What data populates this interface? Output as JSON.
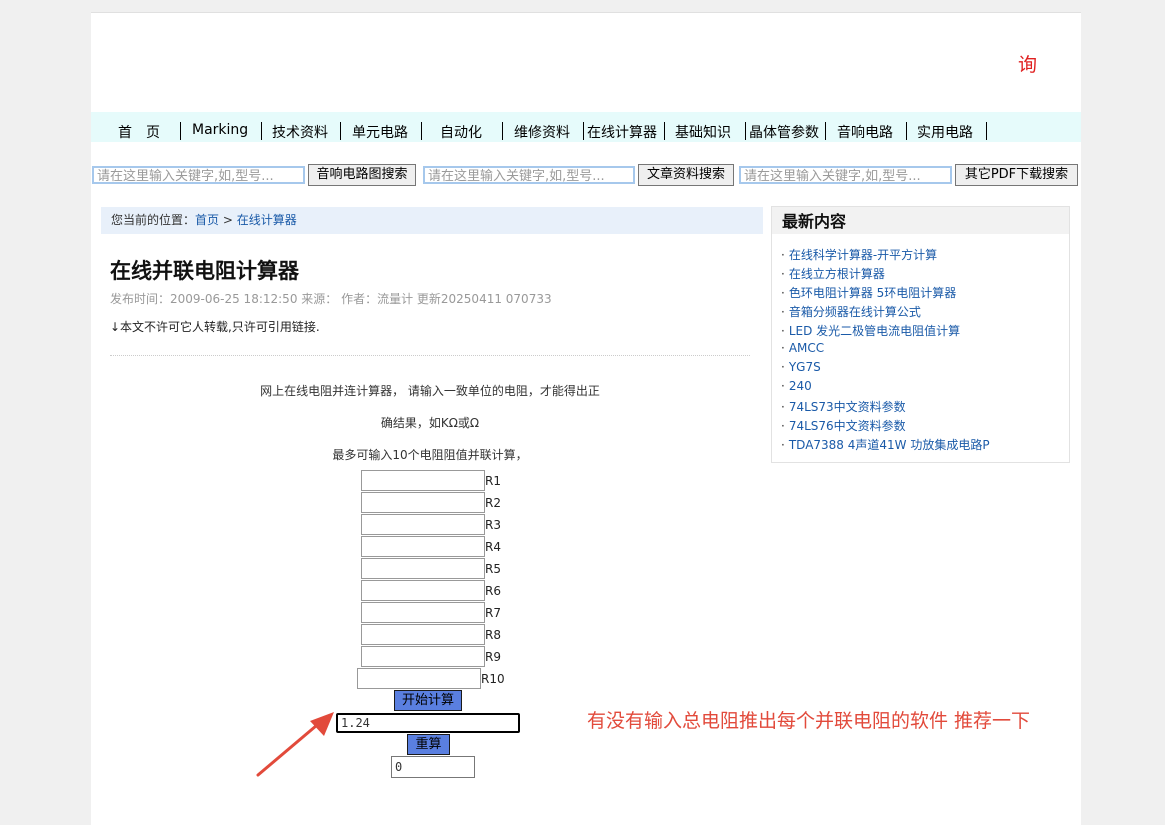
{
  "header": {
    "query_char": "询"
  },
  "nav": [
    "首　页",
    "Marking",
    "技术资料",
    "单元电路",
    "自动化",
    "维修资料",
    "在线计算器",
    "基础知识",
    "晶体管参数",
    "音响电路",
    "实用电路"
  ],
  "search": {
    "placeholder1": "请在这里输入关键字,如,型号...",
    "button1": "音响电路图搜索",
    "placeholder2": "请在这里输入关键字,如,型号...",
    "button2": "文章资料搜索",
    "placeholder3": "请在这里输入关键字,如,型号...",
    "button3": "其它PDF下载搜索"
  },
  "breadcrumb": {
    "prefix": "您当前的位置：",
    "home": "首页",
    "sep": " > ",
    "current": "在线计算器"
  },
  "article": {
    "title": "在线并联电阻计算器",
    "meta": "发布时间：2009-06-25 18:12:50  来源：   作者：流量计  更新20250411 070733",
    "notice": "↓本文不许可它人转载,只许可引用链接.",
    "intro1": "网上在线电阻并连计算器， 请输入一致单位的电阻，才能得出正",
    "intro2": "确结果，如KΩ或Ω",
    "intro3": "最多可输入10个电阻阻值并联计算，"
  },
  "calculator": {
    "labels": [
      "R1",
      "R2",
      "R3",
      "R4",
      "R5",
      "R6",
      "R7",
      "R8",
      "R9",
      "R10"
    ],
    "start_button": "开始计算",
    "result": "1.24",
    "reset_button": "重算",
    "count": "0"
  },
  "annotation": {
    "text": "有没有输入总电阻推出每个并联电阻的软件  推荐一下",
    "color": "#e24a3b"
  },
  "sidebar": {
    "title": "最新内容",
    "items": [
      "在线科学计算器-开平方计算",
      "在线立方根计算器",
      "色环电阻计算器 5环电阻计算器",
      "音箱分频器在线计算公式",
      "LED 发光二极管电流电阻值计算",
      "AMCC",
      "YG7S",
      "240",
      "74LS73中文资料参数",
      "74LS76中文资料参数",
      "TDA7388 4声道41W 功放集成电路P"
    ]
  }
}
